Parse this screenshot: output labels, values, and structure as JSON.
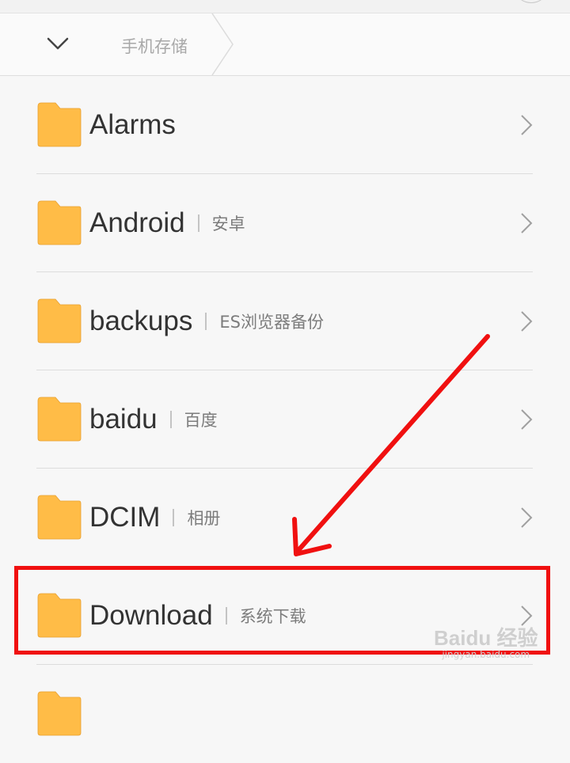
{
  "header": {
    "breadcrumb": "手机存储"
  },
  "folders": [
    {
      "name": "Alarms",
      "desc": ""
    },
    {
      "name": "Android",
      "desc": "安卓"
    },
    {
      "name": "backups",
      "desc": "ES浏览器备份"
    },
    {
      "name": "baidu",
      "desc": "百度"
    },
    {
      "name": "DCIM",
      "desc": "相册"
    },
    {
      "name": "Download",
      "desc": "系统下载"
    }
  ],
  "colors": {
    "folder": "#ffbc47",
    "highlight": "#f01010"
  },
  "watermark": {
    "logo": "Baidu 经验",
    "url": "jingyan.baidu.com"
  }
}
